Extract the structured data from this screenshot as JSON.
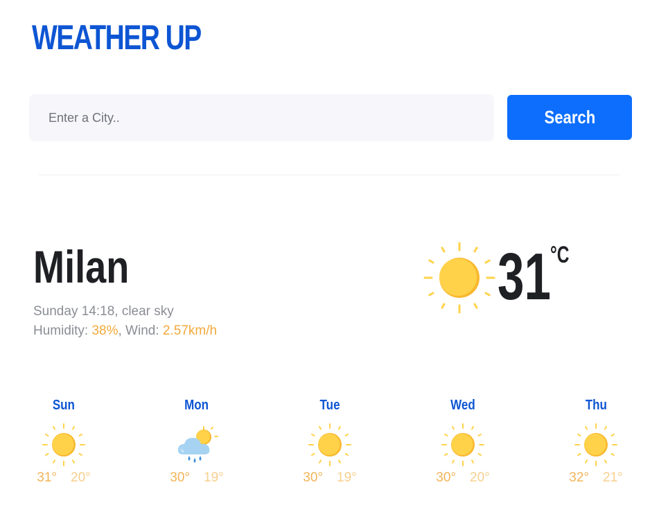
{
  "app": {
    "title": "WEATHER UP"
  },
  "search": {
    "placeholder": "Enter a City..",
    "value": "",
    "button_label": "Search"
  },
  "current": {
    "city": "Milan",
    "datetime_desc": "Sunday 14:18, clear sky",
    "humidity_label": "Humidity: ",
    "humidity_value": "38%",
    "wind_label": ", Wind: ",
    "wind_value": "2.57km/h",
    "temperature": "31",
    "unit": "°C",
    "icon": "sun-icon"
  },
  "forecast": [
    {
      "day": "Sun",
      "high": "31°",
      "low": "20°",
      "icon": "sun-icon"
    },
    {
      "day": "Mon",
      "high": "30°",
      "low": "19°",
      "icon": "rain-cloud-sun-icon"
    },
    {
      "day": "Tue",
      "high": "30°",
      "low": "19°",
      "icon": "sun-icon"
    },
    {
      "day": "Wed",
      "high": "30°",
      "low": "20°",
      "icon": "sun-icon"
    },
    {
      "day": "Thu",
      "high": "32°",
      "low": "21°",
      "icon": "sun-icon"
    }
  ],
  "colors": {
    "brand": "#0d55d3",
    "button": "#0d6efd",
    "accent": "#f2a93b",
    "sun": "#ffd24a"
  }
}
